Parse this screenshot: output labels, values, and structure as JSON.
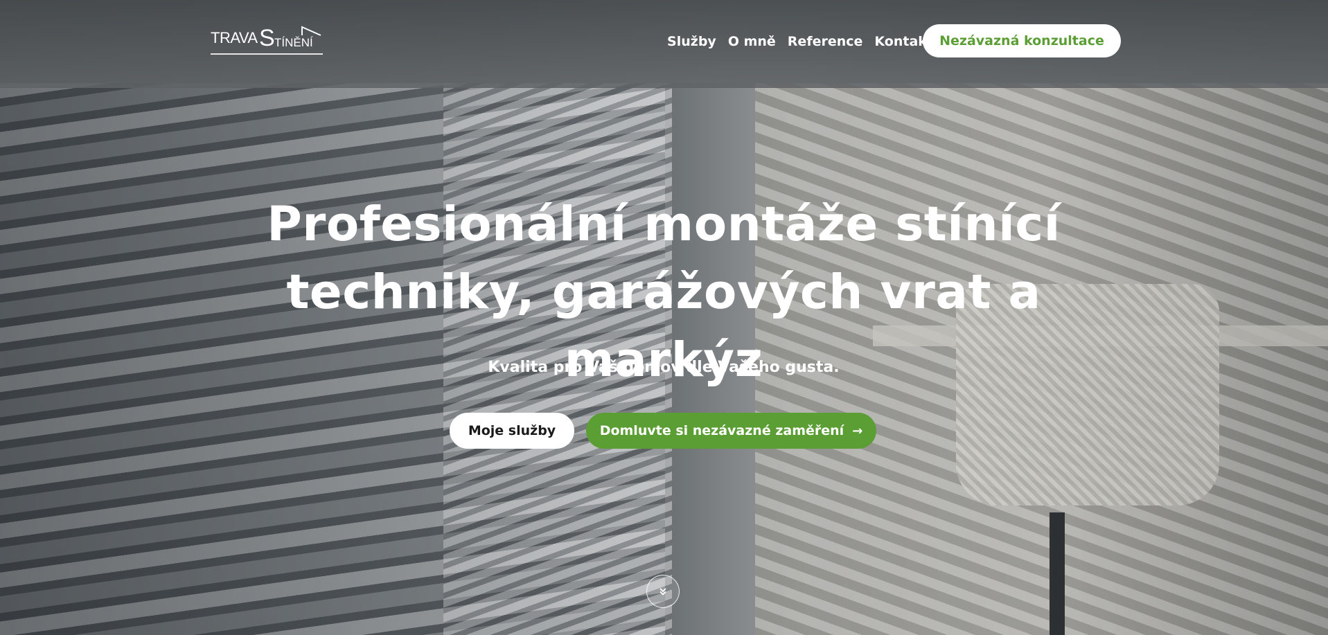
{
  "header": {
    "logo": {
      "part1": "TRAVA",
      "part2": "S",
      "part3": "TÍNĚNÍ"
    },
    "nav": [
      {
        "label": "Služby"
      },
      {
        "label": "O mně"
      },
      {
        "label": "Reference"
      },
      {
        "label": "Kontakt"
      }
    ],
    "cta_label": "Nezávazná konzultace"
  },
  "hero": {
    "title_line1": "Profesionální montáže stínící",
    "title_line2": "techniky, garážových vrat a markýz",
    "subtitle": "Kvalita pro Váš domov dle Vašeho gusta.",
    "primary_button": "Moje služby",
    "secondary_button": "Domluvte si nezávazné zaměření",
    "secondary_icon": "arrow-right-icon",
    "scroll_icon": "double-chevron-down-icon"
  },
  "colors": {
    "accent_green": "#5a9e34",
    "button_white": "#ffffff",
    "text_white": "#ffffff"
  }
}
